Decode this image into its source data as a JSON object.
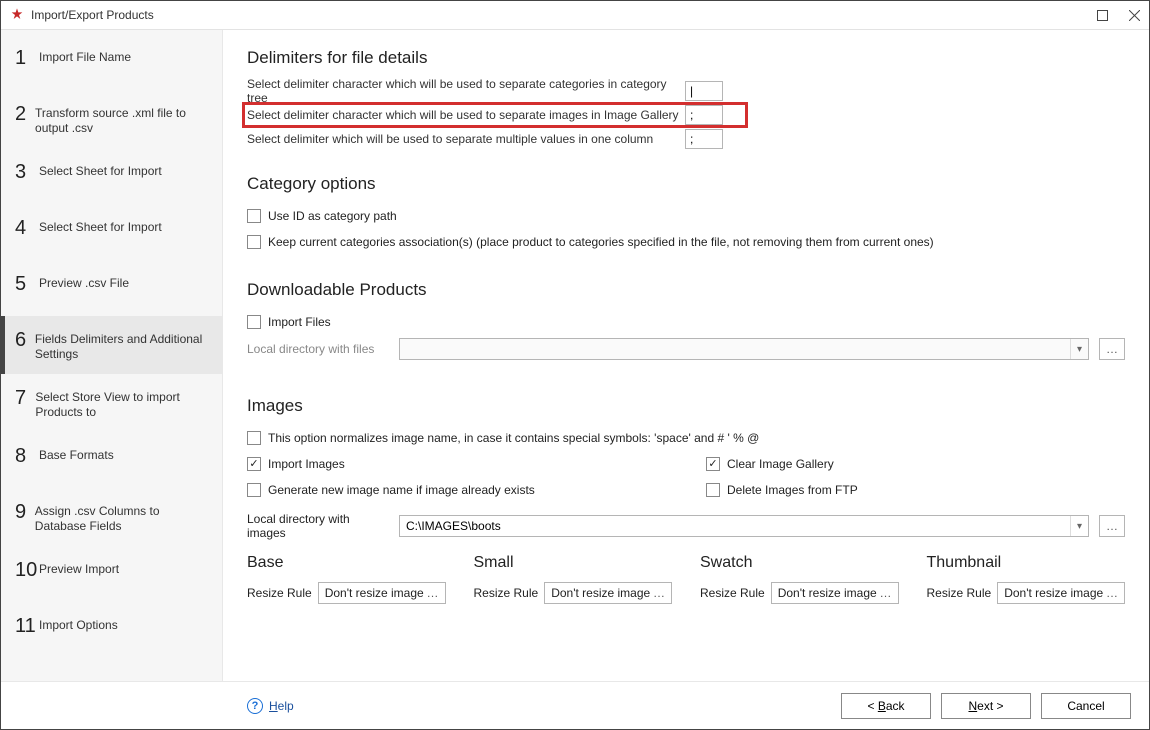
{
  "window": {
    "title": "Import/Export Products"
  },
  "steps": [
    {
      "num": "1",
      "label": "Import File Name"
    },
    {
      "num": "2",
      "label": "Transform source .xml file to output .csv"
    },
    {
      "num": "3",
      "label": "Select Sheet for Import"
    },
    {
      "num": "4",
      "label": "Select Sheet for Import"
    },
    {
      "num": "5",
      "label": "Preview .csv File"
    },
    {
      "num": "6",
      "label": "Fields Delimiters and Additional Settings"
    },
    {
      "num": "7",
      "label": "Select Store View to import Products to"
    },
    {
      "num": "8",
      "label": "Base Formats"
    },
    {
      "num": "9",
      "label": "Assign .csv Columns to Database Fields"
    },
    {
      "num": "10",
      "label": "Preview Import"
    },
    {
      "num": "11",
      "label": "Import Options"
    }
  ],
  "active_step_index": 5,
  "sections": {
    "delimiters": {
      "heading": "Delimiters for file details",
      "rows": [
        {
          "label": "Select delimiter character which will be used to separate categories in category tree",
          "value": "|"
        },
        {
          "label": "Select delimiter character which will be used to separate images in Image Gallery",
          "value": ";"
        },
        {
          "label": "Select delimiter which will be used to separate multiple values in one column",
          "value": ";"
        }
      ]
    },
    "category": {
      "heading": "Category options",
      "use_id_label": "Use ID as category path",
      "keep_categories_label": "Keep current categories association(s) (place product to categories specified in the file, not removing them from current ones)"
    },
    "downloadable": {
      "heading": "Downloadable Products",
      "import_files_label": "Import Files",
      "dir_label": "Local directory with files",
      "dir_value": ""
    },
    "images": {
      "heading": "Images",
      "normalize_label": "This option normalizes image name, in case it contains special symbols: 'space' and # ' % @",
      "import_images_label": "Import Images",
      "clear_gallery_label": "Clear Image Gallery",
      "gen_new_name_label": "Generate new image name if image already exists",
      "delete_ftp_label": "Delete Images from FTP",
      "dir_label": "Local directory with images",
      "dir_value": "C:\\IMAGES\\boots",
      "columns": {
        "base": {
          "title": "Base",
          "resize_label": "Resize Rule",
          "value": "Don't resize image"
        },
        "small": {
          "title": "Small",
          "resize_label": "Resize Rule",
          "value": "Don't resize image"
        },
        "swatch": {
          "title": "Swatch",
          "resize_label": "Resize Rule",
          "value": "Don't resize image"
        },
        "thumbnail": {
          "title": "Thumbnail",
          "resize_label": "Resize Rule",
          "value": "Don't resize image"
        }
      }
    }
  },
  "footer": {
    "help": "Help",
    "back": "< Back",
    "next": "Next >",
    "cancel": "Cancel"
  }
}
